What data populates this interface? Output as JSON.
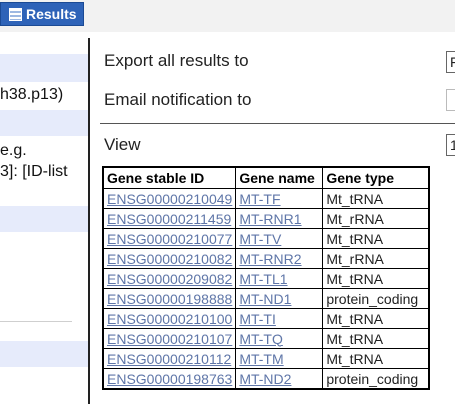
{
  "header": {
    "tab_label": "Results",
    "tab_icon": "table-icon",
    "accent_color": "#2e63b8"
  },
  "left_panel": {
    "lines": [
      "h38.p13)",
      "e.g.",
      "3]: [ID-list"
    ]
  },
  "main": {
    "export_label": "Export  all results to",
    "export_select_value": "F",
    "email_label": "Email notification to",
    "view_label": "View",
    "view_select_value": "1"
  },
  "table": {
    "headers": [
      "Gene stable ID",
      "Gene name",
      "Gene type"
    ],
    "rows": [
      {
        "id": "ENSG00000210049",
        "name": "MT-TF",
        "type": "Mt_tRNA"
      },
      {
        "id": "ENSG00000211459",
        "name": "MT-RNR1",
        "type": "Mt_rRNA"
      },
      {
        "id": "ENSG00000210077",
        "name": "MT-TV",
        "type": "Mt_tRNA"
      },
      {
        "id": "ENSG00000210082",
        "name": "MT-RNR2",
        "type": "Mt_rRNA"
      },
      {
        "id": "ENSG00000209082",
        "name": "MT-TL1",
        "type": "Mt_tRNA"
      },
      {
        "id": "ENSG00000198888",
        "name": "MT-ND1",
        "type": "protein_coding"
      },
      {
        "id": "ENSG00000210100",
        "name": "MT-TI",
        "type": "Mt_tRNA"
      },
      {
        "id": "ENSG00000210107",
        "name": "MT-TQ",
        "type": "Mt_tRNA"
      },
      {
        "id": "ENSG00000210112",
        "name": "MT-TM",
        "type": "Mt_tRNA"
      },
      {
        "id": "ENSG00000198763",
        "name": "MT-ND2",
        "type": "protein_coding"
      }
    ]
  }
}
